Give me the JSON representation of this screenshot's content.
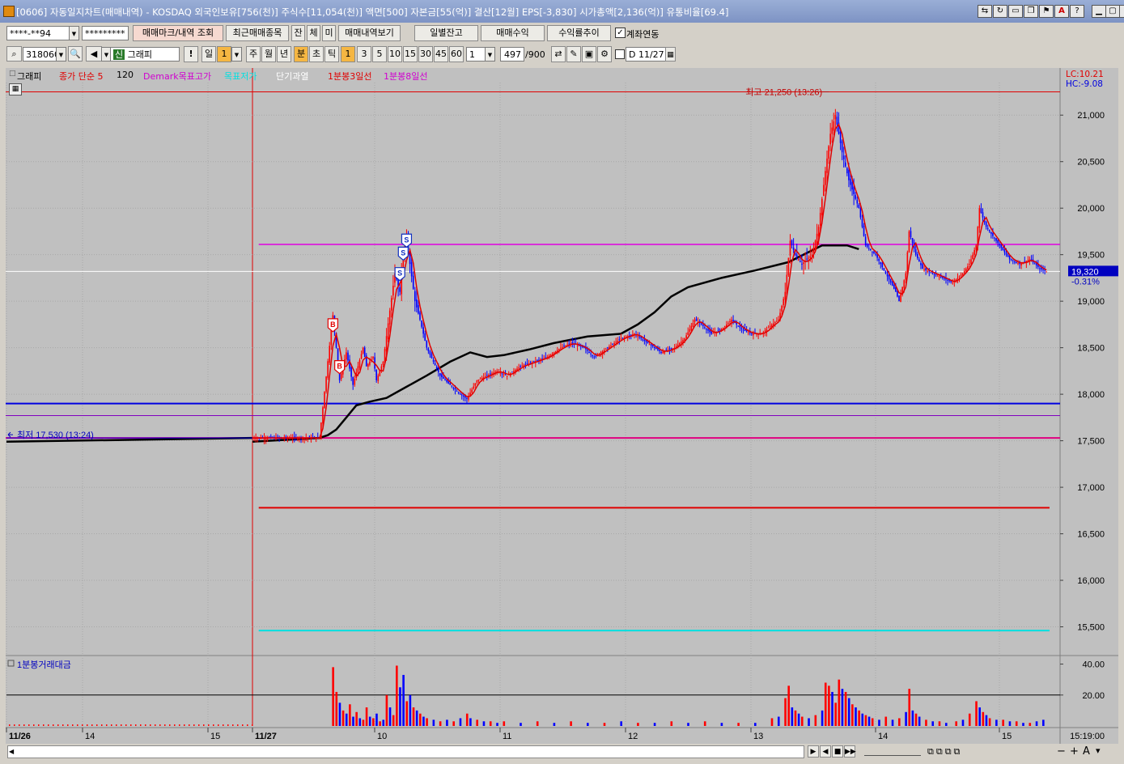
{
  "window": {
    "title": "[0606] 자동일지차트(매매내역) - KOSDAQ 외국인보유[756(천)] 주식수[11,054(천)] 액면[500] 자본금[55(억)] 결산[12월] EPS[-3,830] 시가총액[2,136(억)] 유통비율[69.4]",
    "controls": [
      "minimize-icon",
      "restore-icon",
      "close-icon"
    ]
  },
  "toolbar1": {
    "account": "****-**94",
    "password": "*********",
    "buttons": [
      "매매마크/내역 조회",
      "최근매매종목",
      "잔",
      "체",
      "미",
      "매매내역보기",
      "일별잔고",
      "매매수익",
      "수익률추이"
    ],
    "link_checkbox_label": "계좌연동",
    "link_checked": true
  },
  "toolbar2": {
    "code": "318060",
    "type_badge": "신",
    "type_name": "그래피",
    "period_buttons": [
      "일",
      "1",
      "주",
      "월",
      "년",
      "분",
      "초",
      "틱"
    ],
    "minute_buttons": [
      "1",
      "3",
      "5",
      "10",
      "15",
      "30",
      "45",
      "60"
    ],
    "interval_value": "1",
    "count": "497",
    "count_total": "/900",
    "date": "11/27"
  },
  "legend": {
    "items": [
      {
        "text": "그래피",
        "color": "#000000"
      },
      {
        "text": "종가 단순 5",
        "color": "#e00000"
      },
      {
        "text": "120",
        "color": "#000000"
      },
      {
        "text": "Demark목표고가",
        "color": "#d000d0"
      },
      {
        "text": "목표저가",
        "color": "#00c8c8"
      },
      {
        "text": "단기과열",
        "color": "#ffffff"
      },
      {
        "text": "1분봉3일선",
        "color": "#e00000"
      },
      {
        "text": "1분봉8일선",
        "color": "#d000d0"
      }
    ],
    "lc": "LC:10.21",
    "hc": "HC:-9.08"
  },
  "chart_data": {
    "type": "candlestick",
    "x_labels": [
      "11/26",
      "14",
      "15",
      "11/27",
      "10",
      "11",
      "12",
      "13",
      "14",
      "15"
    ],
    "y_ticks": [
      "21,000",
      "20,500",
      "20,000",
      "19,500",
      "19,000",
      "18,500",
      "18,000",
      "17,500",
      "17,000",
      "16,500",
      "16,000",
      "15,500"
    ],
    "ylim": [
      15200,
      21350
    ],
    "current_price": "19,320",
    "current_change": "-0.31%",
    "high_label": "최고 21,250 (13:26)",
    "low_label": "최저 17,530 (13:24)",
    "high_value": 21250,
    "low_value": 17530,
    "price_path": [
      [
        0,
        17530
      ],
      [
        40,
        17530
      ],
      [
        48,
        18850
      ],
      [
        52,
        18150
      ],
      [
        56,
        18450
      ],
      [
        60,
        18100
      ],
      [
        66,
        18500
      ],
      [
        68,
        18300
      ],
      [
        72,
        18400
      ],
      [
        74,
        18150
      ],
      [
        78,
        18350
      ],
      [
        82,
        18900
      ],
      [
        85,
        19300
      ],
      [
        88,
        19100
      ],
      [
        90,
        19500
      ],
      [
        92,
        19700
      ],
      [
        94,
        19400
      ],
      [
        97,
        19000
      ],
      [
        100,
        18800
      ],
      [
        104,
        18500
      ],
      [
        108,
        18350
      ],
      [
        112,
        18200
      ],
      [
        118,
        18100
      ],
      [
        124,
        18000
      ],
      [
        128,
        17950
      ],
      [
        134,
        18150
      ],
      [
        140,
        18200
      ],
      [
        146,
        18250
      ],
      [
        152,
        18200
      ],
      [
        160,
        18300
      ],
      [
        168,
        18350
      ],
      [
        176,
        18400
      ],
      [
        184,
        18500
      ],
      [
        190,
        18550
      ],
      [
        198,
        18500
      ],
      [
        204,
        18400
      ],
      [
        212,
        18500
      ],
      [
        220,
        18600
      ],
      [
        228,
        18650
      ],
      [
        236,
        18550
      ],
      [
        244,
        18450
      ],
      [
        252,
        18500
      ],
      [
        258,
        18600
      ],
      [
        264,
        18800
      ],
      [
        268,
        18750
      ],
      [
        274,
        18650
      ],
      [
        280,
        18700
      ],
      [
        286,
        18800
      ],
      [
        292,
        18700
      ],
      [
        298,
        18650
      ],
      [
        304,
        18650
      ],
      [
        310,
        18750
      ],
      [
        314,
        18800
      ],
      [
        318,
        19100
      ],
      [
        321,
        19650
      ],
      [
        324,
        19500
      ],
      [
        328,
        19400
      ],
      [
        334,
        19500
      ],
      [
        338,
        19800
      ],
      [
        342,
        20400
      ],
      [
        345,
        20800
      ],
      [
        348,
        21000
      ],
      [
        352,
        20600
      ],
      [
        356,
        20300
      ],
      [
        362,
        20000
      ],
      [
        366,
        19600
      ],
      [
        372,
        19500
      ],
      [
        378,
        19300
      ],
      [
        384,
        19100
      ],
      [
        386,
        19000
      ],
      [
        390,
        19300
      ],
      [
        392,
        19750
      ],
      [
        396,
        19500
      ],
      [
        400,
        19350
      ],
      [
        406,
        19300
      ],
      [
        412,
        19250
      ],
      [
        418,
        19200
      ],
      [
        424,
        19300
      ],
      [
        428,
        19400
      ],
      [
        432,
        19600
      ],
      [
        434,
        20000
      ],
      [
        438,
        19800
      ],
      [
        442,
        19700
      ],
      [
        446,
        19600
      ],
      [
        452,
        19450
      ],
      [
        458,
        19400
      ],
      [
        464,
        19450
      ],
      [
        470,
        19350
      ],
      [
        474,
        19320
      ]
    ],
    "ma120_path": [
      [
        0,
        17490
      ],
      [
        40,
        17530
      ],
      [
        45,
        17560
      ],
      [
        50,
        17620
      ],
      [
        56,
        17750
      ],
      [
        62,
        17880
      ],
      [
        70,
        17920
      ],
      [
        80,
        17960
      ],
      [
        92,
        18080
      ],
      [
        104,
        18200
      ],
      [
        118,
        18350
      ],
      [
        130,
        18450
      ],
      [
        140,
        18400
      ],
      [
        150,
        18420
      ],
      [
        165,
        18480
      ],
      [
        180,
        18550
      ],
      [
        200,
        18620
      ],
      [
        220,
        18650
      ],
      [
        230,
        18750
      ],
      [
        240,
        18880
      ],
      [
        250,
        19050
      ],
      [
        260,
        19150
      ],
      [
        280,
        19250
      ],
      [
        300,
        19330
      ],
      [
        320,
        19420
      ],
      [
        340,
        19600
      ],
      [
        355,
        19600
      ],
      [
        362,
        19560
      ]
    ],
    "ma_visible_range": [
      0,
      474
    ],
    "volume": {
      "label": "1분봉거래대금",
      "y_ticks": [
        "40.00",
        "20.00"
      ],
      "ylim": [
        0,
        45
      ],
      "bars": [
        [
          48,
          38,
          "r"
        ],
        [
          50,
          22,
          "r"
        ],
        [
          52,
          15,
          "b"
        ],
        [
          54,
          10,
          "r"
        ],
        [
          56,
          8,
          "b"
        ],
        [
          58,
          14,
          "r"
        ],
        [
          60,
          6,
          "b"
        ],
        [
          62,
          9,
          "r"
        ],
        [
          64,
          5,
          "b"
        ],
        [
          66,
          4,
          "r"
        ],
        [
          68,
          12,
          "r"
        ],
        [
          70,
          6,
          "b"
        ],
        [
          72,
          5,
          "r"
        ],
        [
          74,
          8,
          "b"
        ],
        [
          76,
          3,
          "r"
        ],
        [
          78,
          4,
          "b"
        ],
        [
          80,
          20,
          "r"
        ],
        [
          82,
          12,
          "b"
        ],
        [
          84,
          7,
          "r"
        ],
        [
          86,
          39,
          "r"
        ],
        [
          88,
          25,
          "b"
        ],
        [
          90,
          33,
          "b"
        ],
        [
          92,
          16,
          "r"
        ],
        [
          94,
          20,
          "b"
        ],
        [
          96,
          12,
          "r"
        ],
        [
          98,
          10,
          "b"
        ],
        [
          100,
          8,
          "r"
        ],
        [
          102,
          6,
          "b"
        ],
        [
          104,
          5,
          "r"
        ],
        [
          108,
          4,
          "b"
        ],
        [
          112,
          3,
          "r"
        ],
        [
          116,
          4,
          "b"
        ],
        [
          120,
          3,
          "r"
        ],
        [
          124,
          5,
          "b"
        ],
        [
          128,
          8,
          "r"
        ],
        [
          130,
          5,
          "b"
        ],
        [
          134,
          4,
          "r"
        ],
        [
          138,
          3,
          "b"
        ],
        [
          142,
          3,
          "r"
        ],
        [
          146,
          2,
          "b"
        ],
        [
          150,
          3,
          "r"
        ],
        [
          160,
          2,
          "b"
        ],
        [
          170,
          3,
          "r"
        ],
        [
          180,
          2,
          "b"
        ],
        [
          190,
          3,
          "r"
        ],
        [
          200,
          2,
          "b"
        ],
        [
          210,
          2,
          "r"
        ],
        [
          220,
          3,
          "b"
        ],
        [
          230,
          2,
          "r"
        ],
        [
          240,
          2,
          "b"
        ],
        [
          250,
          3,
          "r"
        ],
        [
          260,
          2,
          "b"
        ],
        [
          270,
          3,
          "r"
        ],
        [
          280,
          2,
          "b"
        ],
        [
          290,
          2,
          "r"
        ],
        [
          300,
          2,
          "b"
        ],
        [
          310,
          5,
          "r"
        ],
        [
          314,
          6,
          "b"
        ],
        [
          318,
          18,
          "r"
        ],
        [
          320,
          26,
          "r"
        ],
        [
          322,
          12,
          "b"
        ],
        [
          324,
          10,
          "r"
        ],
        [
          326,
          8,
          "b"
        ],
        [
          328,
          6,
          "r"
        ],
        [
          332,
          5,
          "b"
        ],
        [
          336,
          7,
          "r"
        ],
        [
          340,
          10,
          "b"
        ],
        [
          342,
          28,
          "r"
        ],
        [
          344,
          26,
          "r"
        ],
        [
          346,
          22,
          "b"
        ],
        [
          348,
          15,
          "r"
        ],
        [
          350,
          30,
          "r"
        ],
        [
          352,
          24,
          "b"
        ],
        [
          354,
          22,
          "r"
        ],
        [
          356,
          18,
          "b"
        ],
        [
          358,
          14,
          "r"
        ],
        [
          360,
          12,
          "b"
        ],
        [
          362,
          10,
          "r"
        ],
        [
          364,
          8,
          "b"
        ],
        [
          366,
          7,
          "r"
        ],
        [
          368,
          6,
          "b"
        ],
        [
          370,
          5,
          "r"
        ],
        [
          374,
          4,
          "b"
        ],
        [
          378,
          6,
          "r"
        ],
        [
          382,
          4,
          "b"
        ],
        [
          386,
          5,
          "r"
        ],
        [
          390,
          9,
          "b"
        ],
        [
          392,
          24,
          "r"
        ],
        [
          394,
          10,
          "b"
        ],
        [
          396,
          8,
          "r"
        ],
        [
          398,
          6,
          "b"
        ],
        [
          402,
          4,
          "r"
        ],
        [
          406,
          3,
          "b"
        ],
        [
          410,
          3,
          "r"
        ],
        [
          414,
          2,
          "b"
        ],
        [
          420,
          3,
          "r"
        ],
        [
          424,
          4,
          "b"
        ],
        [
          428,
          8,
          "r"
        ],
        [
          432,
          16,
          "r"
        ],
        [
          434,
          12,
          "b"
        ],
        [
          436,
          9,
          "r"
        ],
        [
          438,
          7,
          "b"
        ],
        [
          440,
          5,
          "r"
        ],
        [
          444,
          4,
          "b"
        ],
        [
          448,
          4,
          "r"
        ],
        [
          452,
          3,
          "b"
        ],
        [
          456,
          3,
          "r"
        ],
        [
          460,
          2,
          "b"
        ],
        [
          464,
          2,
          "r"
        ],
        [
          468,
          3,
          "b"
        ],
        [
          472,
          4,
          "b"
        ]
      ]
    },
    "markers": [
      {
        "type": "B",
        "bar": 48,
        "price": 18750,
        "color": "#e00000"
      },
      {
        "type": "B",
        "bar": 52,
        "price": 18300,
        "color": "#e00000"
      },
      {
        "type": "S",
        "bar": 88,
        "price": 19300,
        "color": "#1030c0"
      },
      {
        "type": "S",
        "bar": 90,
        "price": 19520,
        "color": "#1030c0"
      },
      {
        "type": "S",
        "bar": 92,
        "price": 19660,
        "color": "#1030c0"
      }
    ],
    "hlines": [
      {
        "price": 21250,
        "color": "#e00000",
        "from": 0,
        "to": 1,
        "width": 1
      },
      {
        "price": 19610,
        "color": "#e000e0",
        "from": 0.24,
        "to": 1,
        "width": 1.5
      },
      {
        "price": 19320,
        "color": "#ffffff",
        "from": 0,
        "to": 1,
        "width": 1
      },
      {
        "price": 17900,
        "color": "#0000e0",
        "from": 0,
        "to": 1,
        "width": 2
      },
      {
        "price": 17770,
        "color": "#8000c0",
        "from": 0,
        "to": 1,
        "width": 1
      },
      {
        "price": 17530,
        "color": "#e00080",
        "from": 0,
        "to": 1,
        "width": 2
      },
      {
        "price": 16780,
        "color": "#e00000",
        "from": 0.24,
        "to": 0.99,
        "width": 2
      },
      {
        "price": 15460,
        "color": "#00e0e0",
        "from": 0.24,
        "to": 0.99,
        "width": 2
      }
    ],
    "time": "15:19:00"
  },
  "bottombar": {
    "nav_buttons": [
      "▶",
      "◀",
      "■",
      "▶▶"
    ],
    "zoom_buttons": [
      "−",
      "+",
      "A"
    ]
  },
  "colors": {
    "up": "#ff0000",
    "down": "#0000ff",
    "background": "#c0c0c0"
  }
}
